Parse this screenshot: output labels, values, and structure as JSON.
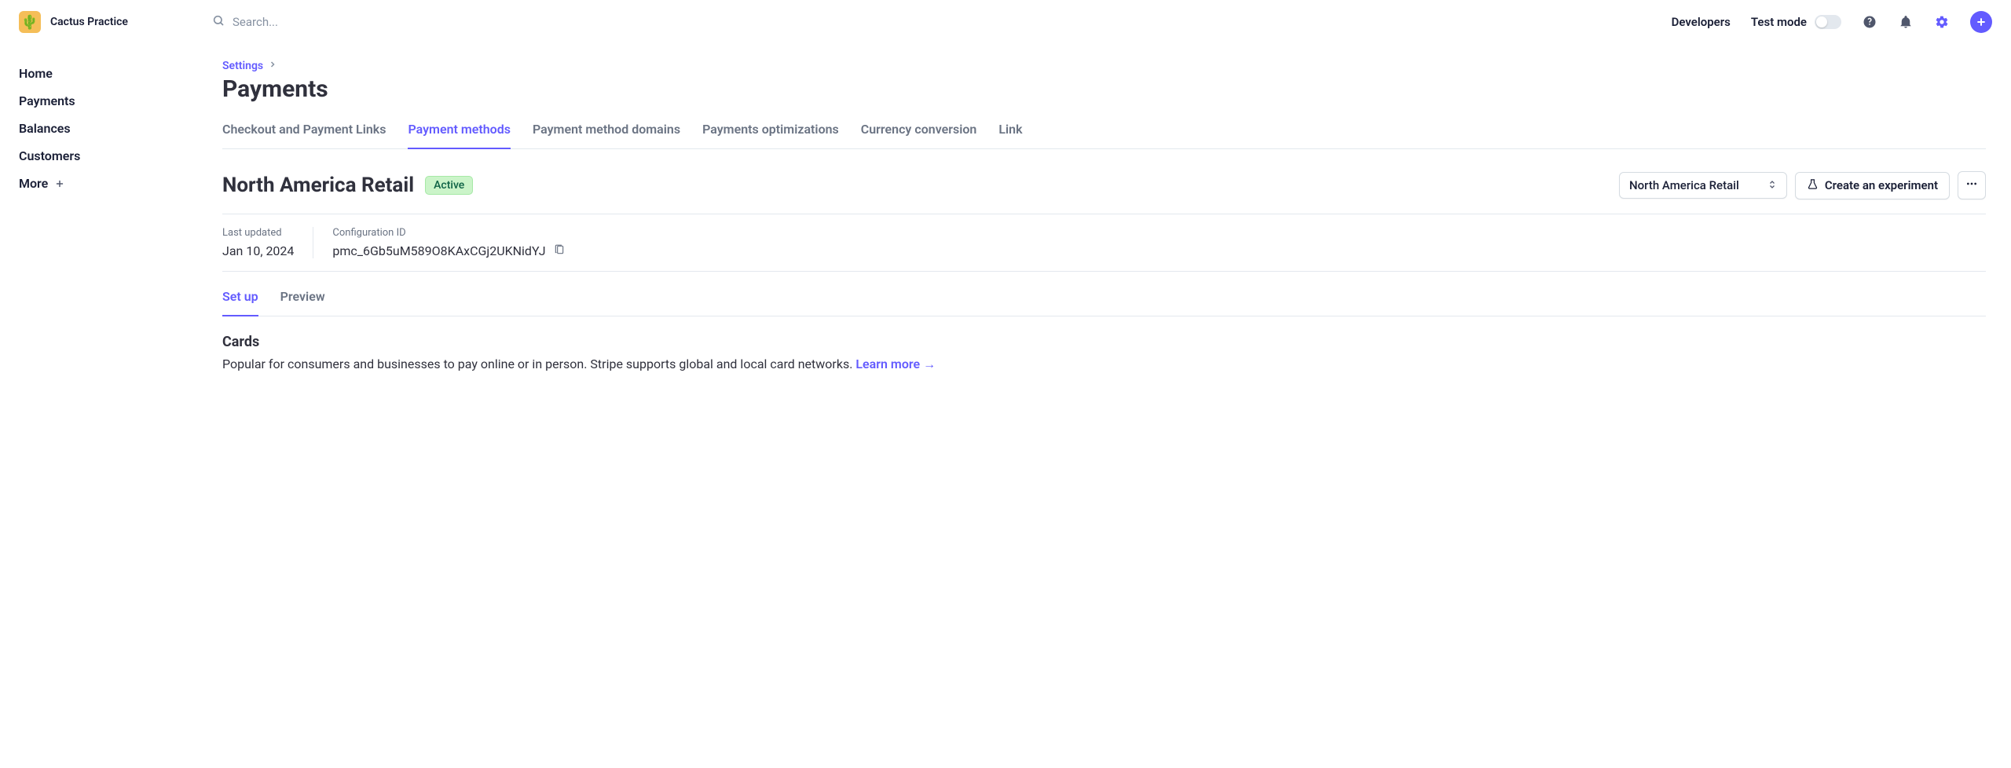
{
  "brand": {
    "name": "Cactus Practice"
  },
  "search": {
    "placeholder": "Search..."
  },
  "topbar": {
    "developers": "Developers",
    "test_mode": "Test mode"
  },
  "sidebar": {
    "items": [
      "Home",
      "Payments",
      "Balances",
      "Customers",
      "More"
    ]
  },
  "breadcrumb": {
    "link": "Settings"
  },
  "page_title": "Payments",
  "tabs": [
    "Checkout and Payment Links",
    "Payment methods",
    "Payment method domains",
    "Payments optimizations",
    "Currency conversion",
    "Link"
  ],
  "config": {
    "title": "North America Retail",
    "badge": "Active",
    "selector": "North America Retail",
    "experiment_btn": "Create an experiment"
  },
  "meta": {
    "last_updated_label": "Last updated",
    "last_updated_value": "Jan 10, 2024",
    "config_id_label": "Configuration ID",
    "config_id_value": "pmc_6Gb5uM589O8KAxCGj2UKNidYJ"
  },
  "subtabs": [
    "Set up",
    "Preview"
  ],
  "section": {
    "title": "Cards",
    "desc": "Popular for consumers and businesses to pay online or in person. Stripe supports global and local card networks. ",
    "learn_more": "Learn more →"
  }
}
